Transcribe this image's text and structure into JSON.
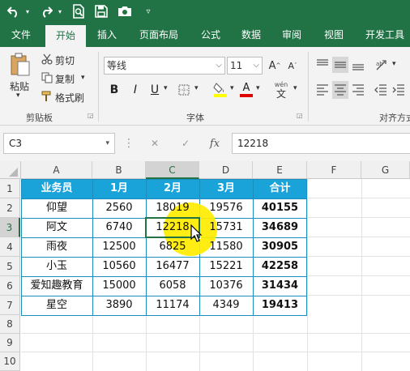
{
  "ribbon": {
    "tabs": [
      "文件",
      "开始",
      "插入",
      "页面布局",
      "公式",
      "数据",
      "审阅",
      "视图",
      "开发工具"
    ],
    "active_tab": "开始",
    "clipboard": {
      "paste": "粘贴",
      "cut": "剪切",
      "copy": "复制",
      "format_painter": "格式刷",
      "group_label": "剪贴板"
    },
    "font": {
      "font_name": "等线",
      "font_size": "11",
      "group_label": "字体",
      "phonetic_label": "wén",
      "phonetic_char": "文"
    },
    "alignment": {
      "group_label": "对齐方式"
    }
  },
  "formula_bar": {
    "name_box": "C3",
    "fx_label": "fx",
    "formula": "12218"
  },
  "sheet": {
    "columns": [
      "A",
      "B",
      "C",
      "D",
      "E",
      "F",
      "G"
    ],
    "rows": [
      "1",
      "2",
      "3",
      "4",
      "5",
      "6",
      "7",
      "8",
      "9",
      "10"
    ],
    "table": {
      "header": [
        "业务员",
        "1月",
        "2月",
        "3月",
        "合计"
      ],
      "body": [
        [
          "仰望",
          "2560",
          "18019",
          "19576",
          "40155"
        ],
        [
          "阿文",
          "6740",
          "12218",
          "15731",
          "34689"
        ],
        [
          "雨夜",
          "12500",
          "6825",
          "11580",
          "30905"
        ],
        [
          "小玉",
          "10560",
          "16477",
          "15221",
          "42258"
        ],
        [
          "爱知趣教育",
          "15000",
          "6058",
          "10376",
          "31434"
        ],
        [
          "星空",
          "3890",
          "11174",
          "4349",
          "19413"
        ]
      ]
    },
    "selected_cell": "C3",
    "header_color": "#1AA3D9",
    "highlight_color": "#FFEB00"
  },
  "colors": {
    "excel_green": "#217346"
  }
}
